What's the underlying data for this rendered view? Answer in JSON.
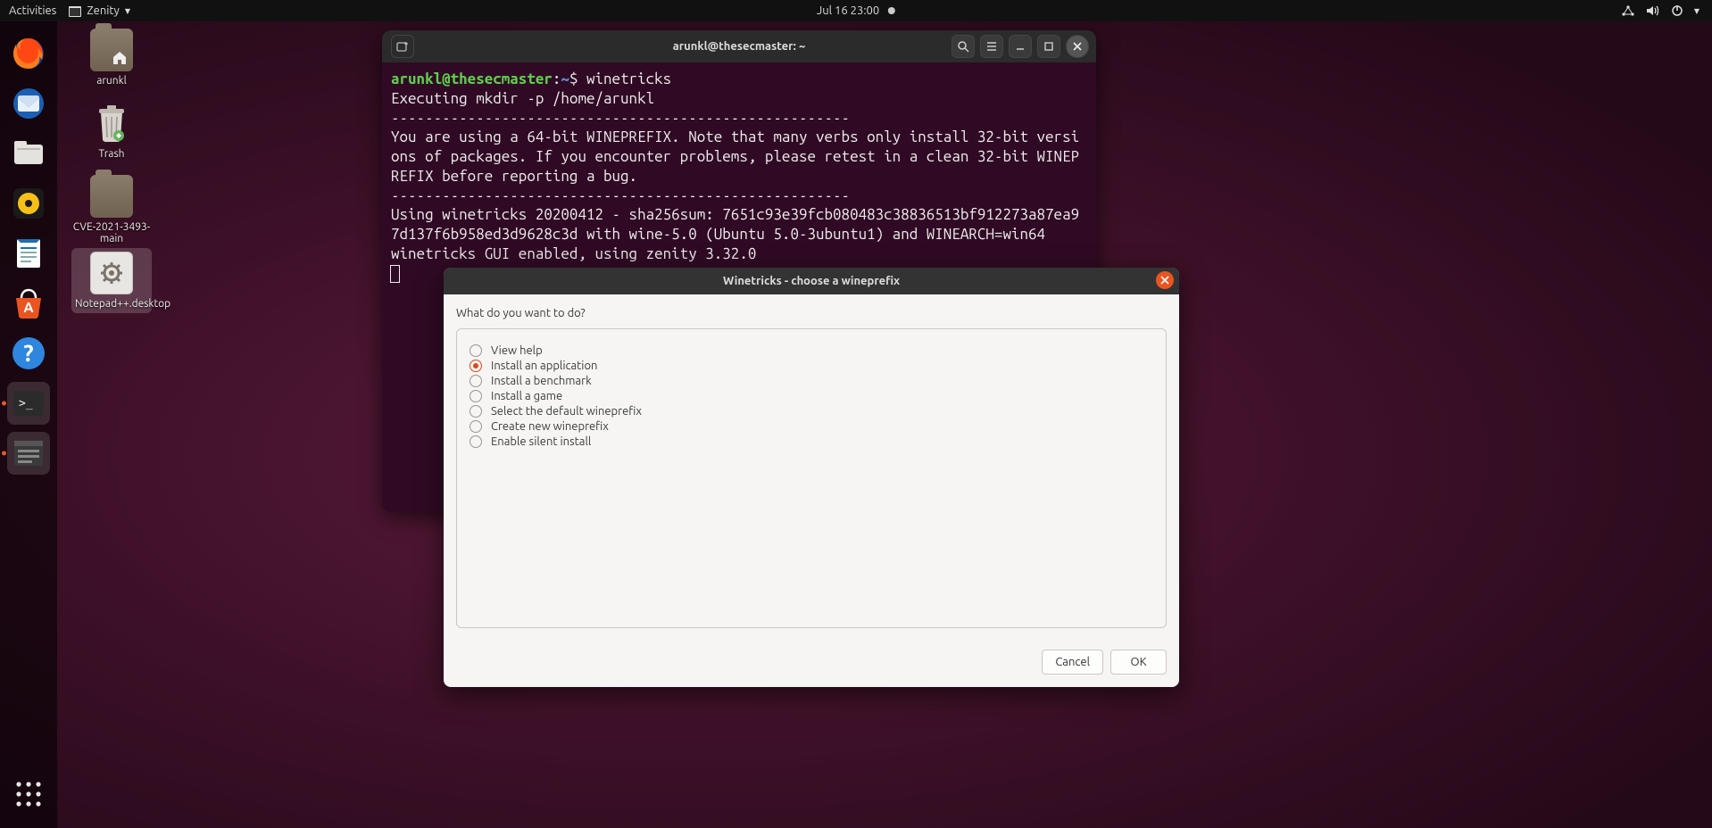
{
  "topbar": {
    "activities": "Activities",
    "app": "Zenity",
    "clock": "Jul 16  23:00"
  },
  "desktop": [
    {
      "label": "arunkl"
    },
    {
      "label": "Trash"
    },
    {
      "label": "CVE-2021-3493-main"
    },
    {
      "label": "Notepad++.desktop"
    }
  ],
  "terminal": {
    "title": "arunkl@thesecmaster: ~",
    "prompt_user": "arunkl@thesecmaster",
    "prompt_sep": ":",
    "prompt_path": "~",
    "prompt_dollar": "$ ",
    "command": "winetricks",
    "output": "Executing mkdir -p /home/arunkl\n------------------------------------------------------\nYou are using a 64-bit WINEPREFIX. Note that many verbs only install 32-bit versions of packages. If you encounter problems, please retest in a clean 32-bit WINEPREFIX before reporting a bug.\n------------------------------------------------------\nUsing winetricks 20200412 - sha256sum: 7651c93e39fcb080483c38836513bf912273a87ea97d137f6b958ed3d9628c3d with wine-5.0 (Ubuntu 5.0-3ubuntu1) and WINEARCH=win64\nwinetricks GUI enabled, using zenity 3.32.0"
  },
  "dialog": {
    "title": "Winetricks - choose a wineprefix",
    "prompt": "What do you want to do?",
    "options": [
      {
        "label": "View help",
        "checked": false
      },
      {
        "label": "Install an application",
        "checked": true
      },
      {
        "label": "Install a benchmark",
        "checked": false
      },
      {
        "label": "Install a game",
        "checked": false
      },
      {
        "label": "Select the default wineprefix",
        "checked": false
      },
      {
        "label": "Create new wineprefix",
        "checked": false
      },
      {
        "label": "Enable silent install",
        "checked": false
      }
    ],
    "cancel": "Cancel",
    "ok": "OK"
  }
}
